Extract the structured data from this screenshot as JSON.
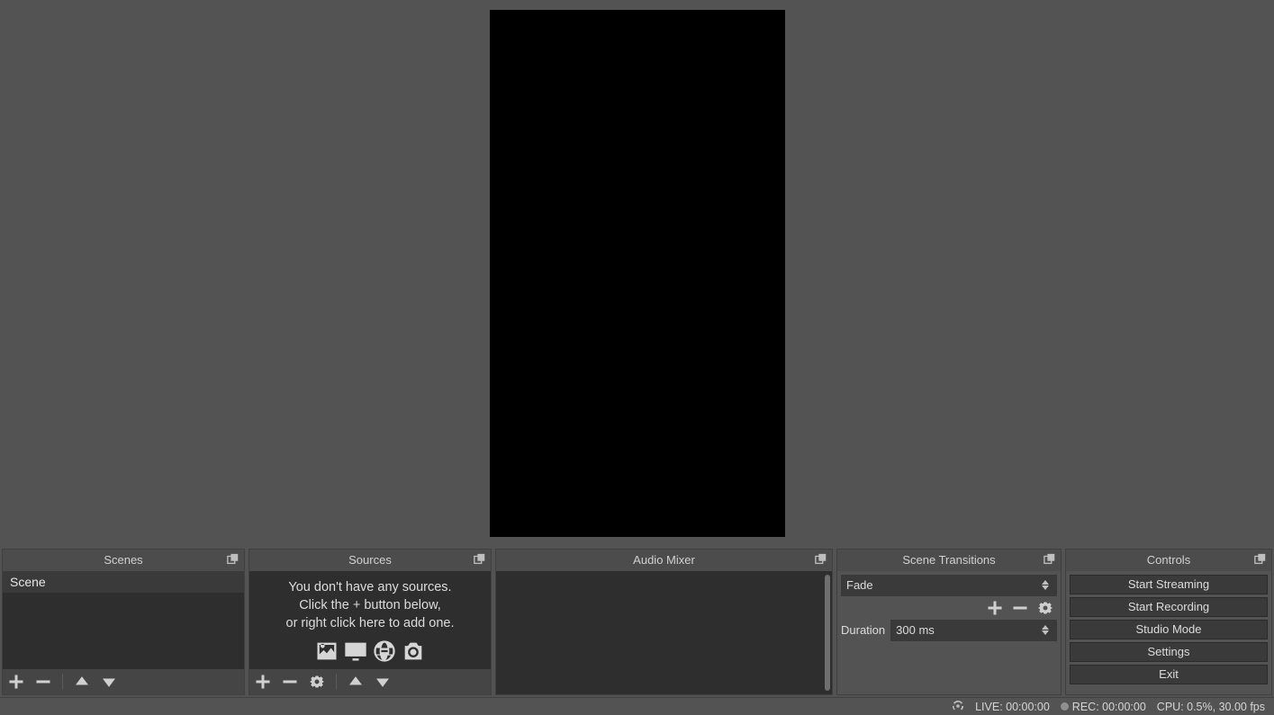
{
  "scenes": {
    "title": "Scenes",
    "items": [
      "Scene"
    ]
  },
  "sources": {
    "title": "Sources",
    "empty_line1": "You don't have any sources.",
    "empty_line2": "Click the + button below,",
    "empty_line3": "or right click here to add one."
  },
  "mixer": {
    "title": "Audio Mixer"
  },
  "transitions": {
    "title": "Scene Transitions",
    "selected": "Fade",
    "duration_label": "Duration",
    "duration_value": "300 ms"
  },
  "controls": {
    "title": "Controls",
    "buttons": {
      "start_streaming": "Start Streaming",
      "start_recording": "Start Recording",
      "studio_mode": "Studio Mode",
      "settings": "Settings",
      "exit": "Exit"
    }
  },
  "statusbar": {
    "live": "LIVE: 00:00:00",
    "rec": "REC: 00:00:00",
    "cpu": "CPU: 0.5%, 30.00 fps"
  }
}
